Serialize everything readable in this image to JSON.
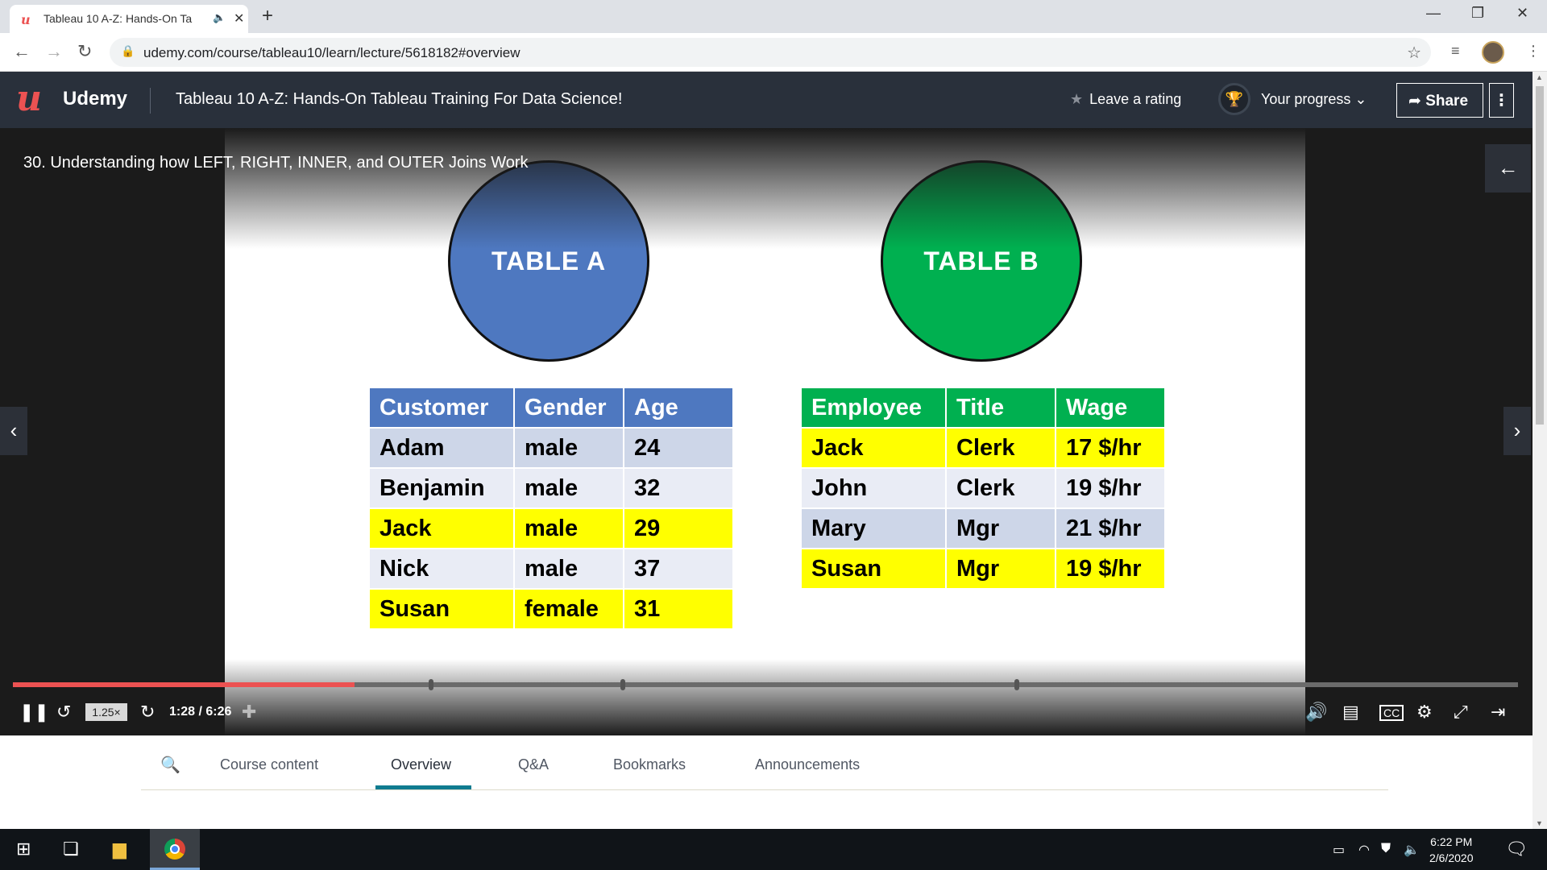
{
  "browser": {
    "tab_title": "Tableau 10 A-Z: Hands-On Ta",
    "url": "udemy.com/course/tableau10/learn/lecture/5618182#overview"
  },
  "header": {
    "logo_text": "Udemy",
    "course_title": "Tableau 10 A-Z: Hands-On Tableau Training For Data Science!",
    "leave_rating": "Leave a rating",
    "your_progress": "Your progress",
    "share": "Share"
  },
  "video": {
    "lecture_title": "30. Understanding how LEFT, RIGHT, INNER, and OUTER Joins Work",
    "speed": "1.25×",
    "timecode": "1:28 / 6:26",
    "progress_fraction": 0.227,
    "markers": [
      0.278,
      0.405,
      0.667
    ],
    "slide": {
      "table_a": {
        "label": "TABLE A",
        "headers": [
          "Customer",
          "Gender",
          "Age"
        ],
        "rows": [
          {
            "cells": [
              "Adam",
              "male",
              "24"
            ],
            "style": "dark"
          },
          {
            "cells": [
              "Benjamin",
              "male",
              "32"
            ],
            "style": "light"
          },
          {
            "cells": [
              "Jack",
              "male",
              "29"
            ],
            "style": "hl"
          },
          {
            "cells": [
              "Nick",
              "male",
              "37"
            ],
            "style": "light"
          },
          {
            "cells": [
              "Susan",
              "female",
              "31"
            ],
            "style": "hl"
          }
        ]
      },
      "table_b": {
        "label": "TABLE B",
        "headers": [
          "Employee",
          "Title",
          "Wage"
        ],
        "rows": [
          {
            "cells": [
              "Jack",
              "Clerk",
              "17 $/hr"
            ],
            "style": "hl"
          },
          {
            "cells": [
              "John",
              "Clerk",
              "19 $/hr"
            ],
            "style": "light"
          },
          {
            "cells": [
              "Mary",
              "Mgr",
              "21 $/hr"
            ],
            "style": "dark"
          },
          {
            "cells": [
              "Susan",
              "Mgr",
              "19 $/hr"
            ],
            "style": "hl"
          }
        ]
      }
    }
  },
  "tabs": [
    "Course content",
    "Overview",
    "Q&A",
    "Bookmarks",
    "Announcements"
  ],
  "active_tab": "Overview",
  "taskbar": {
    "time": "6:22 PM",
    "date": "2/6/2020"
  },
  "colors": {
    "udemy_red": "#ec5252",
    "header_bg": "#29303b",
    "table_a_blue": "#4e78c0",
    "table_b_green": "#00b050",
    "highlight_yellow": "#ffff00",
    "active_tab_teal": "#0f7c90"
  },
  "icons": [
    "back-icon",
    "forward-icon",
    "reload-icon",
    "lock-icon",
    "star-icon",
    "playlist-icon",
    "pause-icon",
    "rewind-icon",
    "forward-5-icon",
    "bookmark-add-icon",
    "volume-icon",
    "transcript-icon",
    "cc-icon",
    "settings-icon",
    "fullscreen-icon",
    "theater-icon",
    "search-icon",
    "trophy-icon",
    "share-icon"
  ]
}
